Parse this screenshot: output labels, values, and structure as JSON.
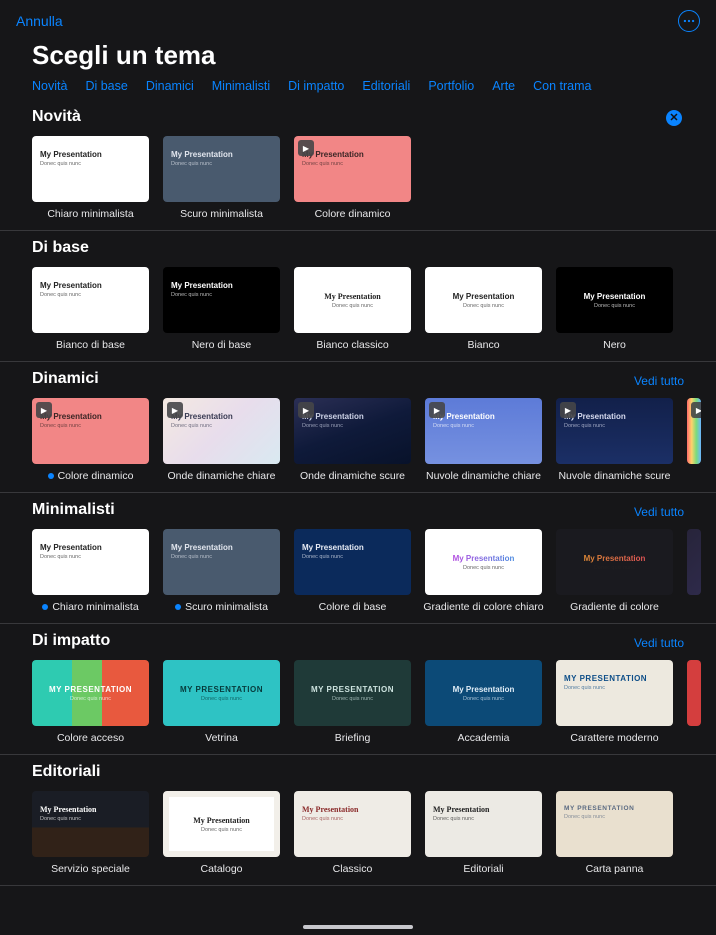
{
  "header": {
    "cancel": "Annulla",
    "title": "Scegli un tema"
  },
  "tabs": [
    "Novità",
    "Di base",
    "Dinamici",
    "Minimalisti",
    "Di impatto",
    "Editoriali",
    "Portfolio",
    "Arte",
    "Con trama"
  ],
  "see_all_label": "Vedi tutto",
  "thumb_text": {
    "title": "My Presentation",
    "subtitle": "Donec quis nunc",
    "title_upper": "MY PRESENTATION"
  },
  "sections": [
    {
      "id": "novita",
      "title": "Novità",
      "header_action": "close",
      "see_all": false,
      "items": [
        {
          "label": "Chiaro minimalista",
          "style": "th-white left-col",
          "play": false,
          "new_dot": false
        },
        {
          "label": "Scuro minimalista",
          "style": "th-slate left-col",
          "play": false,
          "new_dot": false
        },
        {
          "label": "Colore dinamico",
          "style": "th-coral left-col",
          "play": true,
          "new_dot": false
        }
      ]
    },
    {
      "id": "dibase",
      "title": "Di base",
      "see_all": false,
      "items": [
        {
          "label": "Bianco di base",
          "style": "th-white left-col",
          "play": false
        },
        {
          "label": "Nero di base",
          "style": "th-black left-col",
          "play": false
        },
        {
          "label": "Bianco classico",
          "style": "th-white center-only th-center serif",
          "play": false
        },
        {
          "label": "Bianco",
          "style": "th-white center-only th-center",
          "play": false
        },
        {
          "label": "Nero",
          "style": "th-black center-only th-center",
          "play": false
        }
      ]
    },
    {
      "id": "dinamici",
      "title": "Dinamici",
      "see_all": true,
      "items": [
        {
          "label": "Colore dinamico",
          "style": "th-coral left-col",
          "play": true,
          "new_dot": true
        },
        {
          "label": "Onde dinamiche chiare",
          "style": "th-gradlight left-col",
          "play": true
        },
        {
          "label": "Onde dinamiche scure",
          "style": "th-graddark left-col",
          "play": true
        },
        {
          "label": "Nuvole dinamiche chiare",
          "style": "th-clouds-light left-col",
          "play": true
        },
        {
          "label": "Nuvole dinamiche scure",
          "style": "th-clouds-dark left-col",
          "play": true
        },
        {
          "label": "",
          "style": "th-rainbow",
          "play": true,
          "peek": true
        }
      ]
    },
    {
      "id": "minimalisti",
      "title": "Minimalisti",
      "see_all": true,
      "items": [
        {
          "label": "Chiaro minimalista",
          "style": "th-white left-col",
          "play": false,
          "new_dot": true
        },
        {
          "label": "Scuro minimalista",
          "style": "th-slate left-col",
          "play": false,
          "new_dot": true
        },
        {
          "label": "Colore di base",
          "style": "th-navy left-col",
          "play": false
        },
        {
          "label": "Gradiente di colore chiaro",
          "style": "th-grad-wh center-only th-center",
          "play": false
        },
        {
          "label": "Gradiente di colore",
          "style": "th-grad-dk center-only th-center",
          "play": false
        },
        {
          "label": "",
          "style": "th-purplemix",
          "play": false,
          "peek": true
        }
      ]
    },
    {
      "id": "diimpatto",
      "title": "Di impatto",
      "see_all": true,
      "items": [
        {
          "label": "Colore acceso",
          "style": "th-color-bold center-only upper",
          "play": false
        },
        {
          "label": "Vetrina",
          "style": "th-teal center-only upper",
          "play": false
        },
        {
          "label": "Briefing",
          "style": "th-brief center-only upper",
          "play": false
        },
        {
          "label": "Accademia",
          "style": "th-sea center-only",
          "play": false
        },
        {
          "label": "Carattere moderno",
          "style": "th-mod left-col upper",
          "play": false
        },
        {
          "label": "",
          "style": "th-red",
          "play": false,
          "peek": true
        }
      ]
    },
    {
      "id": "editoriali",
      "title": "Editoriali",
      "see_all": false,
      "items": [
        {
          "label": "Servizio speciale",
          "style": "th-arena left-col serif",
          "play": false
        },
        {
          "label": "Catalogo",
          "style": "th-catalog center-only serif",
          "play": false
        },
        {
          "label": "Classico",
          "style": "th-classic left-col serif",
          "play": false
        },
        {
          "label": "Editoriali",
          "style": "th-edit left-col serif",
          "play": false
        },
        {
          "label": "Carta panna",
          "style": "th-cream left-col small-caps",
          "play": false
        }
      ]
    }
  ]
}
